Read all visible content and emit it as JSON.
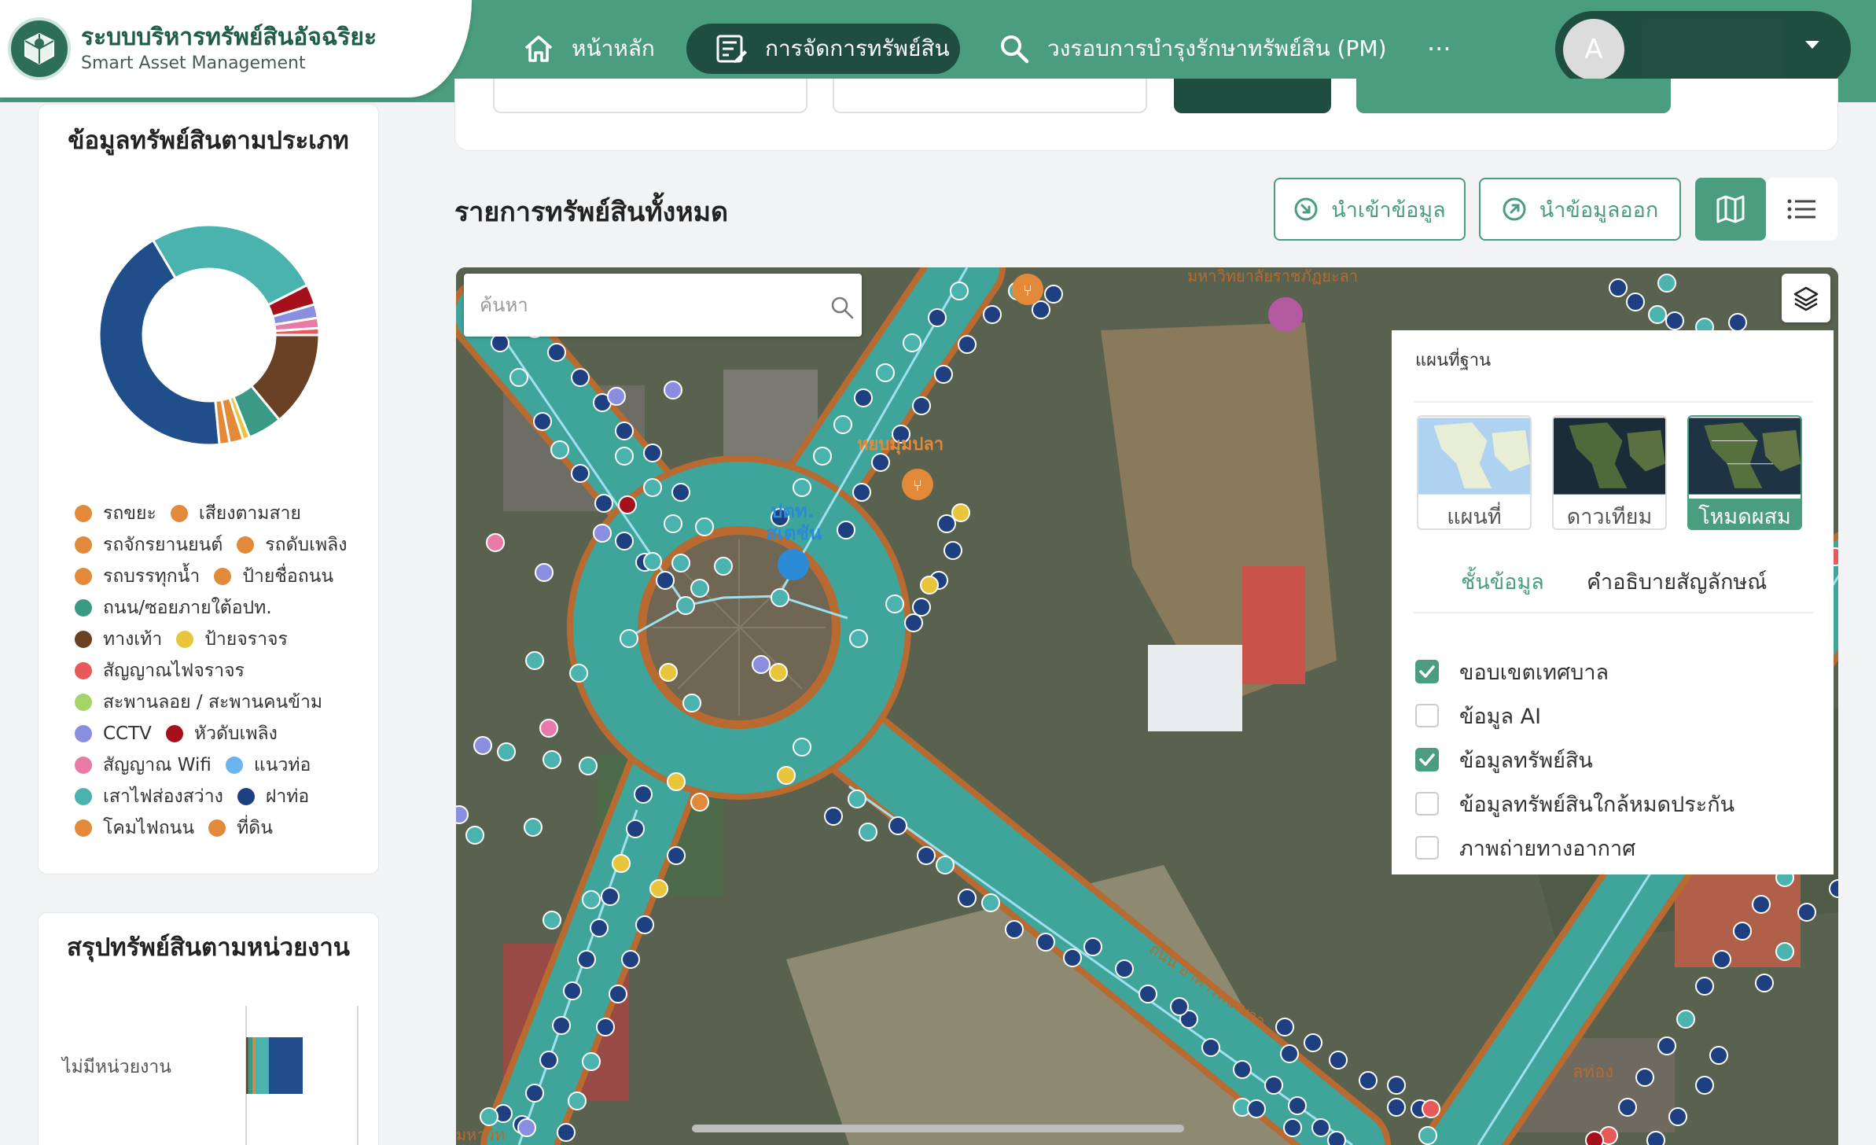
{
  "brand": {
    "title": "ระบบบริหารทรัพย์สินอัจฉริยะ",
    "subtitle": "Smart Asset Management"
  },
  "nav": {
    "home": "หน้าหลัก",
    "assets": "การจัดการทรัพย์สิน",
    "pm": "วงรอบการบำรุงรักษาทรัพย์สิน (PM)",
    "more": "···"
  },
  "user": {
    "avatar_letter": "A"
  },
  "sidebar": {
    "type_title": "ข้อมูลทรัพย์สินตามประเภท",
    "dept_title": "สรุปทรัพย์สินตามหน่วยงาน",
    "dept_label": "ไม่มีหน่วยงาน",
    "legend_rows": [
      [
        {
          "label": "รถขยะ",
          "color": "#e38a3a"
        },
        {
          "label": "เสียงตามสาย",
          "color": "#e38a3a"
        }
      ],
      [
        {
          "label": "รถจักรยานยนต์",
          "color": "#e38a3a"
        },
        {
          "label": "รถดับเพลิง",
          "color": "#e38a3a"
        }
      ],
      [
        {
          "label": "รถบรรทุกน้ำ",
          "color": "#e38a3a"
        },
        {
          "label": "ป้ายชื่อถนน",
          "color": "#e38a3a"
        }
      ],
      [
        {
          "label": "ถนน/ซอยภายใต้อปท.",
          "color": "#3a9a86"
        }
      ],
      [
        {
          "label": "ทางเท้า",
          "color": "#6b4126"
        },
        {
          "label": "ป้ายจราจร",
          "color": "#e8c53a"
        }
      ],
      [
        {
          "label": "สัญญาณไฟจราจร",
          "color": "#e85a5a"
        }
      ],
      [
        {
          "label": "สะพานลอย / สะพานคนข้าม",
          "color": "#a5d46a"
        }
      ],
      [
        {
          "label": "CCTV",
          "color": "#8a8ee0"
        },
        {
          "label": "หัวดับเพลิง",
          "color": "#a5101b"
        }
      ],
      [
        {
          "label": "สัญญาณ Wifi",
          "color": "#e87aa8"
        },
        {
          "label": "แนวท่อ",
          "color": "#6ab4ef"
        }
      ],
      [
        {
          "label": "เสาไฟส่องสว่าง",
          "color": "#4bb3ae"
        },
        {
          "label": "ฝาท่อ",
          "color": "#1e3f80"
        }
      ],
      [
        {
          "label": "โคมไฟถนน",
          "color": "#e38a3a"
        },
        {
          "label": "ที่ดิน",
          "color": "#e38a3a"
        }
      ]
    ]
  },
  "chart_data": [
    {
      "type": "pie",
      "donut": true,
      "values": [
        43,
        26,
        3,
        2,
        1.5,
        1,
        14,
        5,
        1,
        2,
        1.5
      ],
      "colors": [
        "#1f4e8a",
        "#4bb3ae",
        "#a5101b",
        "#8a8ee0",
        "#e87aa8",
        "#e85a5a",
        "#6b4126",
        "#3a9a86",
        "#e8c53a",
        "#e38a3a",
        "#e38a3a"
      ]
    },
    {
      "type": "bar",
      "stacked": true,
      "horizontal": true,
      "categories": [
        "ไม่มีหน่วยงาน"
      ],
      "series_values": [
        4,
        8,
        4,
        24,
        60
      ],
      "series_colors": [
        "#6b4126",
        "#3a9a86",
        "#e38a3a",
        "#4bb3ae",
        "#1f4e8a"
      ]
    }
  ],
  "main": {
    "title": "รายการทรัพย์สินทั้งหมด",
    "import_btn": "นำเข้าข้อมูล",
    "export_btn": "นำข้อมูลออก"
  },
  "map": {
    "search_placeholder": "ค้นหา",
    "labels": {
      "university": "มหาวิทยาลัยราชภัฏยะลา",
      "place1": "หยบมุมปลา",
      "place2": "ปตท.",
      "place3": "สเตชัน",
      "roadA": "ถนน อาคารเทศบาล",
      "roadB": "ลท่อง",
      "roadC": "มหาวิท"
    },
    "layer_panel": {
      "basemap_title": "แผนที่ฐาน",
      "basemaps": [
        "แผนที่",
        "ดาวเทียม",
        "โหมดผสม"
      ],
      "selected_basemap": "โหมดผสม",
      "tab_layers": "ชั้นข้อมูล",
      "tab_legend": "คำอธิบายสัญลักษณ์",
      "layers": [
        {
          "label": "ขอบเขตเทศบาล",
          "checked": true
        },
        {
          "label": "ข้อมูล AI",
          "checked": false
        },
        {
          "label": "ข้อมูลทรัพย์สิน",
          "checked": true
        },
        {
          "label": "ข้อมูลทรัพย์สินใกล้หมดประกัน",
          "checked": false
        },
        {
          "label": "ภาพถ่ายทางอากาศ",
          "checked": false
        }
      ]
    }
  }
}
